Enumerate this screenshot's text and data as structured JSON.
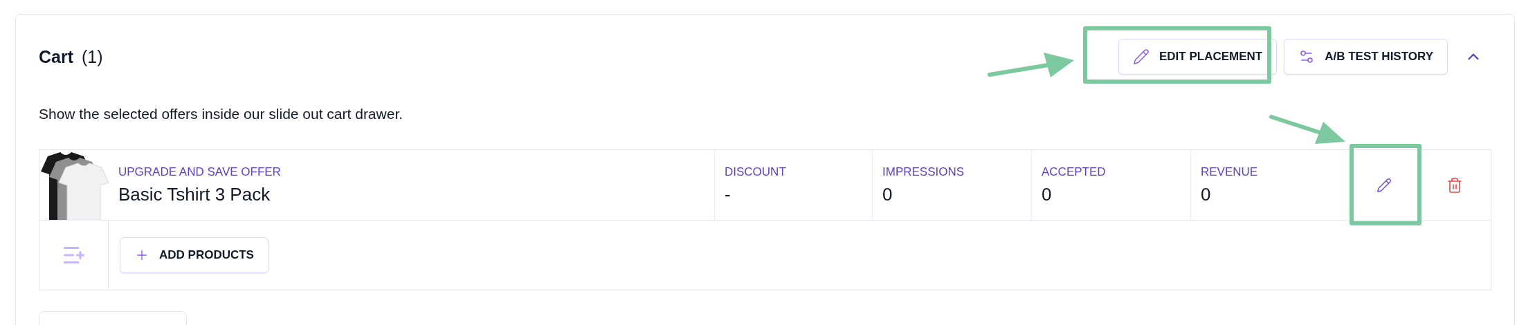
{
  "section": {
    "title": "Cart",
    "count": "(1)",
    "expanded": true,
    "description": "Show the selected offers inside our slide out cart drawer."
  },
  "actions": [
    {
      "label": "EDIT PLACEMENT"
    },
    {
      "label": "A/B TEST HISTORY"
    }
  ],
  "offers": [
    {
      "label": "UPGRADE AND SAVE OFFER",
      "name": "Basic Tshirt 3 Pack",
      "stats": [
        {
          "label": "DISCOUNT",
          "value": "-"
        },
        {
          "label": "IMPRESSIONS",
          "value": "0"
        },
        {
          "label": "ACCEPTED",
          "value": "0"
        },
        {
          "label": "REVENUE",
          "value": "0"
        }
      ]
    }
  ],
  "add_button": {
    "label": "ADD PRODUCTS"
  }
}
